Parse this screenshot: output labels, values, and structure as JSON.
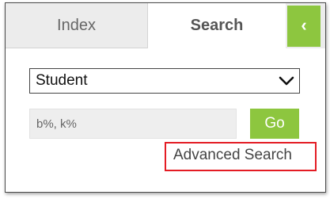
{
  "tabs": {
    "index_label": "Index",
    "search_label": "Search"
  },
  "collapse": {
    "glyph": "‹",
    "icon": "chevron-left-icon",
    "color": "#8dc63f"
  },
  "search": {
    "type_selected": "Student",
    "input_placeholder": "b%, k%",
    "input_value": "",
    "go_label": "Go",
    "advanced_label": "Advanced Search",
    "highlight_color": "#e41c24"
  }
}
